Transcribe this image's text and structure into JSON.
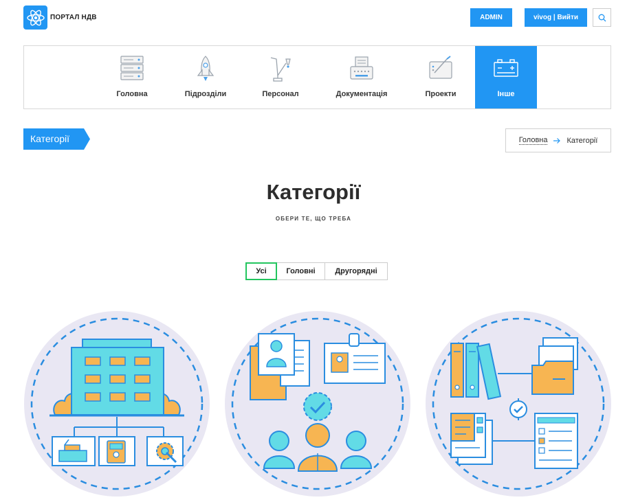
{
  "header": {
    "logo_text": "ПОРТАЛ НДВ",
    "admin_label": "ADMIN",
    "user_label": "vivog | Вийти"
  },
  "nav": {
    "items": [
      {
        "label": "Головна",
        "icon": "server-icon"
      },
      {
        "label": "Підрозділи",
        "icon": "rocket-icon"
      },
      {
        "label": "Персонал",
        "icon": "lamp-icon"
      },
      {
        "label": "Документація",
        "icon": "typewriter-icon"
      },
      {
        "label": "Проекти",
        "icon": "drawing-tablet-icon"
      },
      {
        "label": "Інше",
        "icon": "battery-icon"
      }
    ],
    "active_index": 5
  },
  "page": {
    "tag_label": "Категорії",
    "breadcrumb": {
      "home": "Головна",
      "current": "Категорії"
    },
    "title": "Категорії",
    "subtitle": "ОБЕРИ ТЕ, ЩО ТРЕБА"
  },
  "filters": {
    "items": [
      "Усі",
      "Головні",
      "Другорядні"
    ],
    "active_index": 0
  },
  "cards": [
    {
      "icon": "organization-structure-icon"
    },
    {
      "icon": "personnel-team-icon"
    },
    {
      "icon": "documents-folders-icon"
    }
  ],
  "colors": {
    "accent": "#2196f3",
    "active_filter_border": "#22c55e",
    "illustration_bg": "#e9e7f3",
    "illustration_teal": "#62dbe6",
    "illustration_orange": "#f7b552",
    "illustration_line": "#2a8de0"
  }
}
